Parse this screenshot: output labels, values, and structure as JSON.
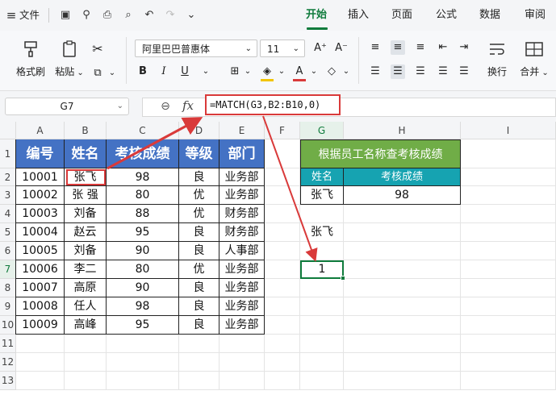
{
  "menubar": {
    "menu_label": "文件",
    "tabs": [
      {
        "label": "开始",
        "active": true
      },
      {
        "label": "插入",
        "active": false
      },
      {
        "label": "页面",
        "active": false
      },
      {
        "label": "公式",
        "active": false
      },
      {
        "label": "数据",
        "active": false
      },
      {
        "label": "审阅",
        "active": false
      }
    ],
    "accent_color": "#0f7b3c"
  },
  "ribbon": {
    "format_painter": "格式刷",
    "paste": "粘贴",
    "font_name": "阿里巴巴普惠体",
    "font_size": "11",
    "wrap": "换行",
    "merge": "合并"
  },
  "formula_bar": {
    "cell_ref": "G7",
    "fx_label": "fx",
    "formula": "=MATCH(G3,B2:B10,0)"
  },
  "columns": [
    "A",
    "B",
    "C",
    "D",
    "E",
    "F",
    "G",
    "H",
    "I"
  ],
  "rows": [
    "1",
    "2",
    "3",
    "4",
    "5",
    "6",
    "7",
    "8",
    "9",
    "10",
    "11",
    "12",
    "13"
  ],
  "table": {
    "headers": [
      "编号",
      "姓名",
      "考核成绩",
      "等级",
      "部门"
    ],
    "rows": [
      [
        "10001",
        "张飞",
        "98",
        "良",
        "业务部"
      ],
      [
        "10002",
        "张 强",
        "80",
        "优",
        "业务部"
      ],
      [
        "10003",
        "刘备",
        "88",
        "优",
        "财务部"
      ],
      [
        "10004",
        "赵云",
        "95",
        "良",
        "财务部"
      ],
      [
        "10005",
        "刘备",
        "90",
        "良",
        "人事部"
      ],
      [
        "10006",
        "李二",
        "80",
        "优",
        "业务部"
      ],
      [
        "10007",
        "高原",
        "90",
        "良",
        "业务部"
      ],
      [
        "10008",
        "任人",
        "98",
        "良",
        "业务部"
      ],
      [
        "10009",
        "高峰",
        "95",
        "良",
        "业务部"
      ]
    ],
    "header_color": "#4472c4"
  },
  "lookup": {
    "title": "根据员工名称查考核成绩",
    "col1": "姓名",
    "col2": "考核成绩",
    "name": "张飞",
    "score": "98",
    "title_color": "#70ad47",
    "subheader_color": "#16a3b1"
  },
  "g5_value": "张飞",
  "g7_value": "1",
  "highlight_color": "#d93a3a"
}
